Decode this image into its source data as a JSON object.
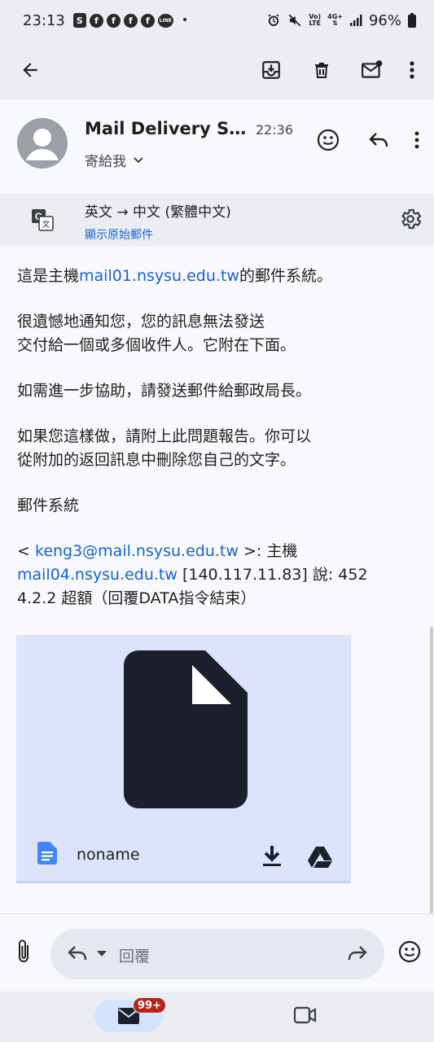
{
  "status_bar": {
    "time": "23:13",
    "notification_icons": [
      "shopee-icon",
      "facebook-icon",
      "facebook-icon",
      "facebook-icon",
      "facebook-icon",
      "line-icon"
    ],
    "more_indicator": "•",
    "network_label_top": "Vo)",
    "network_label_bottom": "LTE",
    "data_label_top": "4G+",
    "battery": "96%"
  },
  "app_bar": {
    "icons": [
      "back-arrow-icon",
      "archive-icon",
      "delete-icon",
      "mark-unread-icon",
      "more-vert-icon"
    ]
  },
  "message": {
    "sender_name": "Mail Delivery System",
    "time": "22:36",
    "recipient": "寄給我",
    "header_icons": [
      "emoji-icon",
      "reply-icon",
      "more-vert-icon"
    ]
  },
  "translate": {
    "languages": "英文 → 中文 (繁體中文)",
    "show_original": "顯示原始郵件"
  },
  "body": {
    "p1_prefix": "這是主機",
    "p1_link": "mail01.nsysu.edu.tw",
    "p1_suffix": "的郵件系統。",
    "p2_line1": "很遺憾地通知您，您的訊息無法發送",
    "p2_line2": "交付給一個或多個收件人。它附在下面。",
    "p3": "如需進一步協助，請發送郵件給郵政局長。",
    "p4_line1": "如果您這樣做，請附上此問題報告。你可以",
    "p4_line2": "從附加的返回訊息中刪除您自己的文字。",
    "p5": "郵件系統",
    "p6_prefix": "< ",
    "p6_email": "keng3@mail.nsysu.edu.tw",
    "p6_middle": " >: 主機",
    "p6_host": "mail04.nsysu.edu.tw",
    "p6_after_host": " [140.117.11.83] 說: 452",
    "p6_line3": "4.2.2 超額（回覆DATA指令結束）"
  },
  "attachment": {
    "name": "noname",
    "icons": [
      "file-icon",
      "doc-icon",
      "download-icon",
      "drive-icon"
    ]
  },
  "reply_bar": {
    "placeholder": "回覆"
  },
  "bottom_nav": {
    "mail_badge": "99+",
    "tabs": [
      "mail-icon",
      "meet-icon"
    ]
  },
  "colors": {
    "link": "#1a62c9",
    "badge": "#b3261e",
    "attachment_bg": "#dde3fa",
    "chrome_bg": "#ebedf3",
    "page_bg": "#f8f9fc"
  }
}
